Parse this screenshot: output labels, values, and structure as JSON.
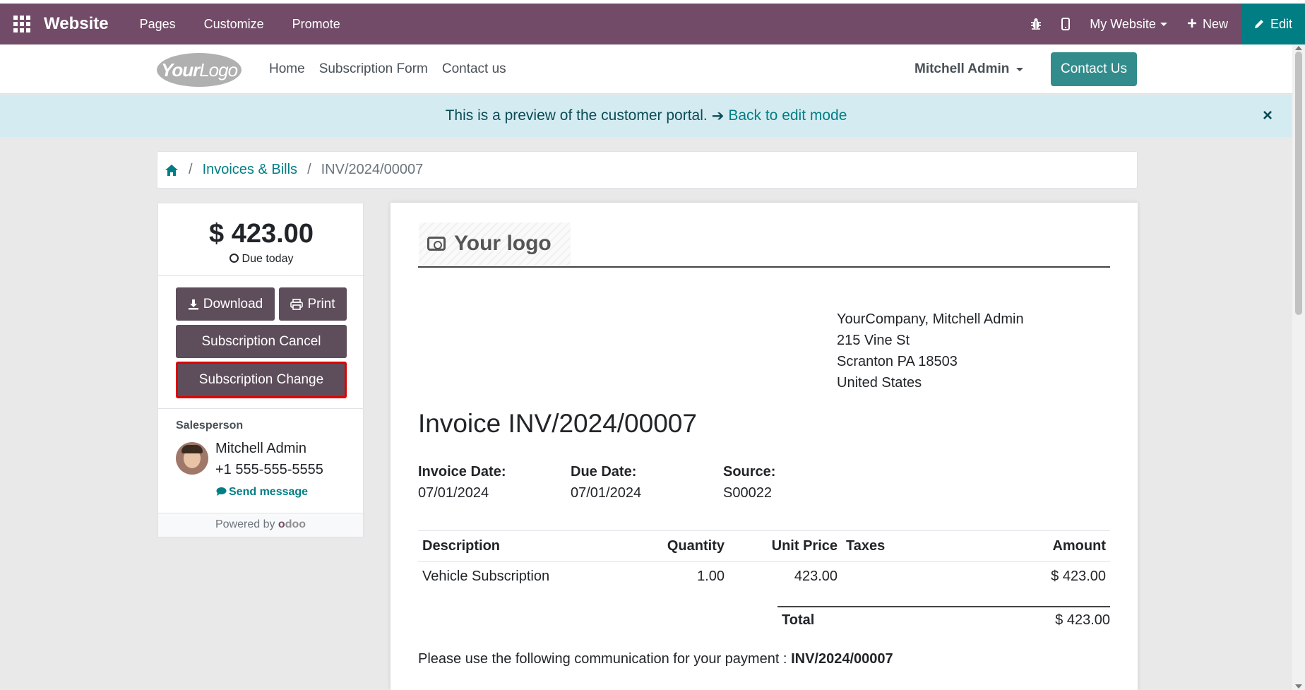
{
  "admin_bar": {
    "app_name": "Website",
    "menus": [
      "Pages",
      "Customize",
      "Promote"
    ],
    "website_selector": "My Website",
    "new_label": "New",
    "edit_label": "Edit",
    "colors": {
      "bar": "#714b67",
      "edit": "#017e84"
    }
  },
  "site_header": {
    "logo_text_bold": "Your",
    "logo_text_light": "Logo",
    "nav": [
      "Home",
      "Subscription Form",
      "Contact us"
    ],
    "user": "Mitchell Admin",
    "contact_button": "Contact Us"
  },
  "banner": {
    "text": "This is a preview of the customer portal.",
    "link": "Back to edit mode",
    "close": "×"
  },
  "breadcrumb": {
    "home_icon": "home-icon",
    "items": [
      "Invoices & Bills",
      "INV/2024/00007"
    ]
  },
  "sidebar": {
    "amount": "$ 423.00",
    "due": "Due today",
    "buttons": {
      "download": "Download",
      "print": "Print",
      "cancel": "Subscription Cancel",
      "change": "Subscription Change"
    },
    "salesperson_label": "Salesperson",
    "salesperson_name": "Mitchell Admin",
    "salesperson_phone": "+1 555-555-5555",
    "send_message": "Send message",
    "powered_by": "Powered by",
    "odoo_o": "o",
    "odoo_rest": "doo"
  },
  "invoice": {
    "logo_placeholder": "Your logo",
    "address": [
      "YourCompany, Mitchell Admin",
      "215 Vine St",
      "Scranton PA 18503",
      "United States"
    ],
    "title": "Invoice INV/2024/00007",
    "invoice_date_label": "Invoice Date:",
    "invoice_date": "07/01/2024",
    "due_date_label": "Due Date:",
    "due_date": "07/01/2024",
    "source_label": "Source:",
    "source": "S00022",
    "table": {
      "headers": [
        "Description",
        "Quantity",
        "Unit Price",
        "Taxes",
        "Amount"
      ],
      "rows": [
        [
          "Vehicle Subscription",
          "1.00",
          "423.00",
          "",
          "$ 423.00"
        ]
      ]
    },
    "total_label": "Total",
    "total_value": "$ 423.00",
    "payment_note": "Please use the following communication for your payment :",
    "payment_reference": "INV/2024/00007"
  }
}
